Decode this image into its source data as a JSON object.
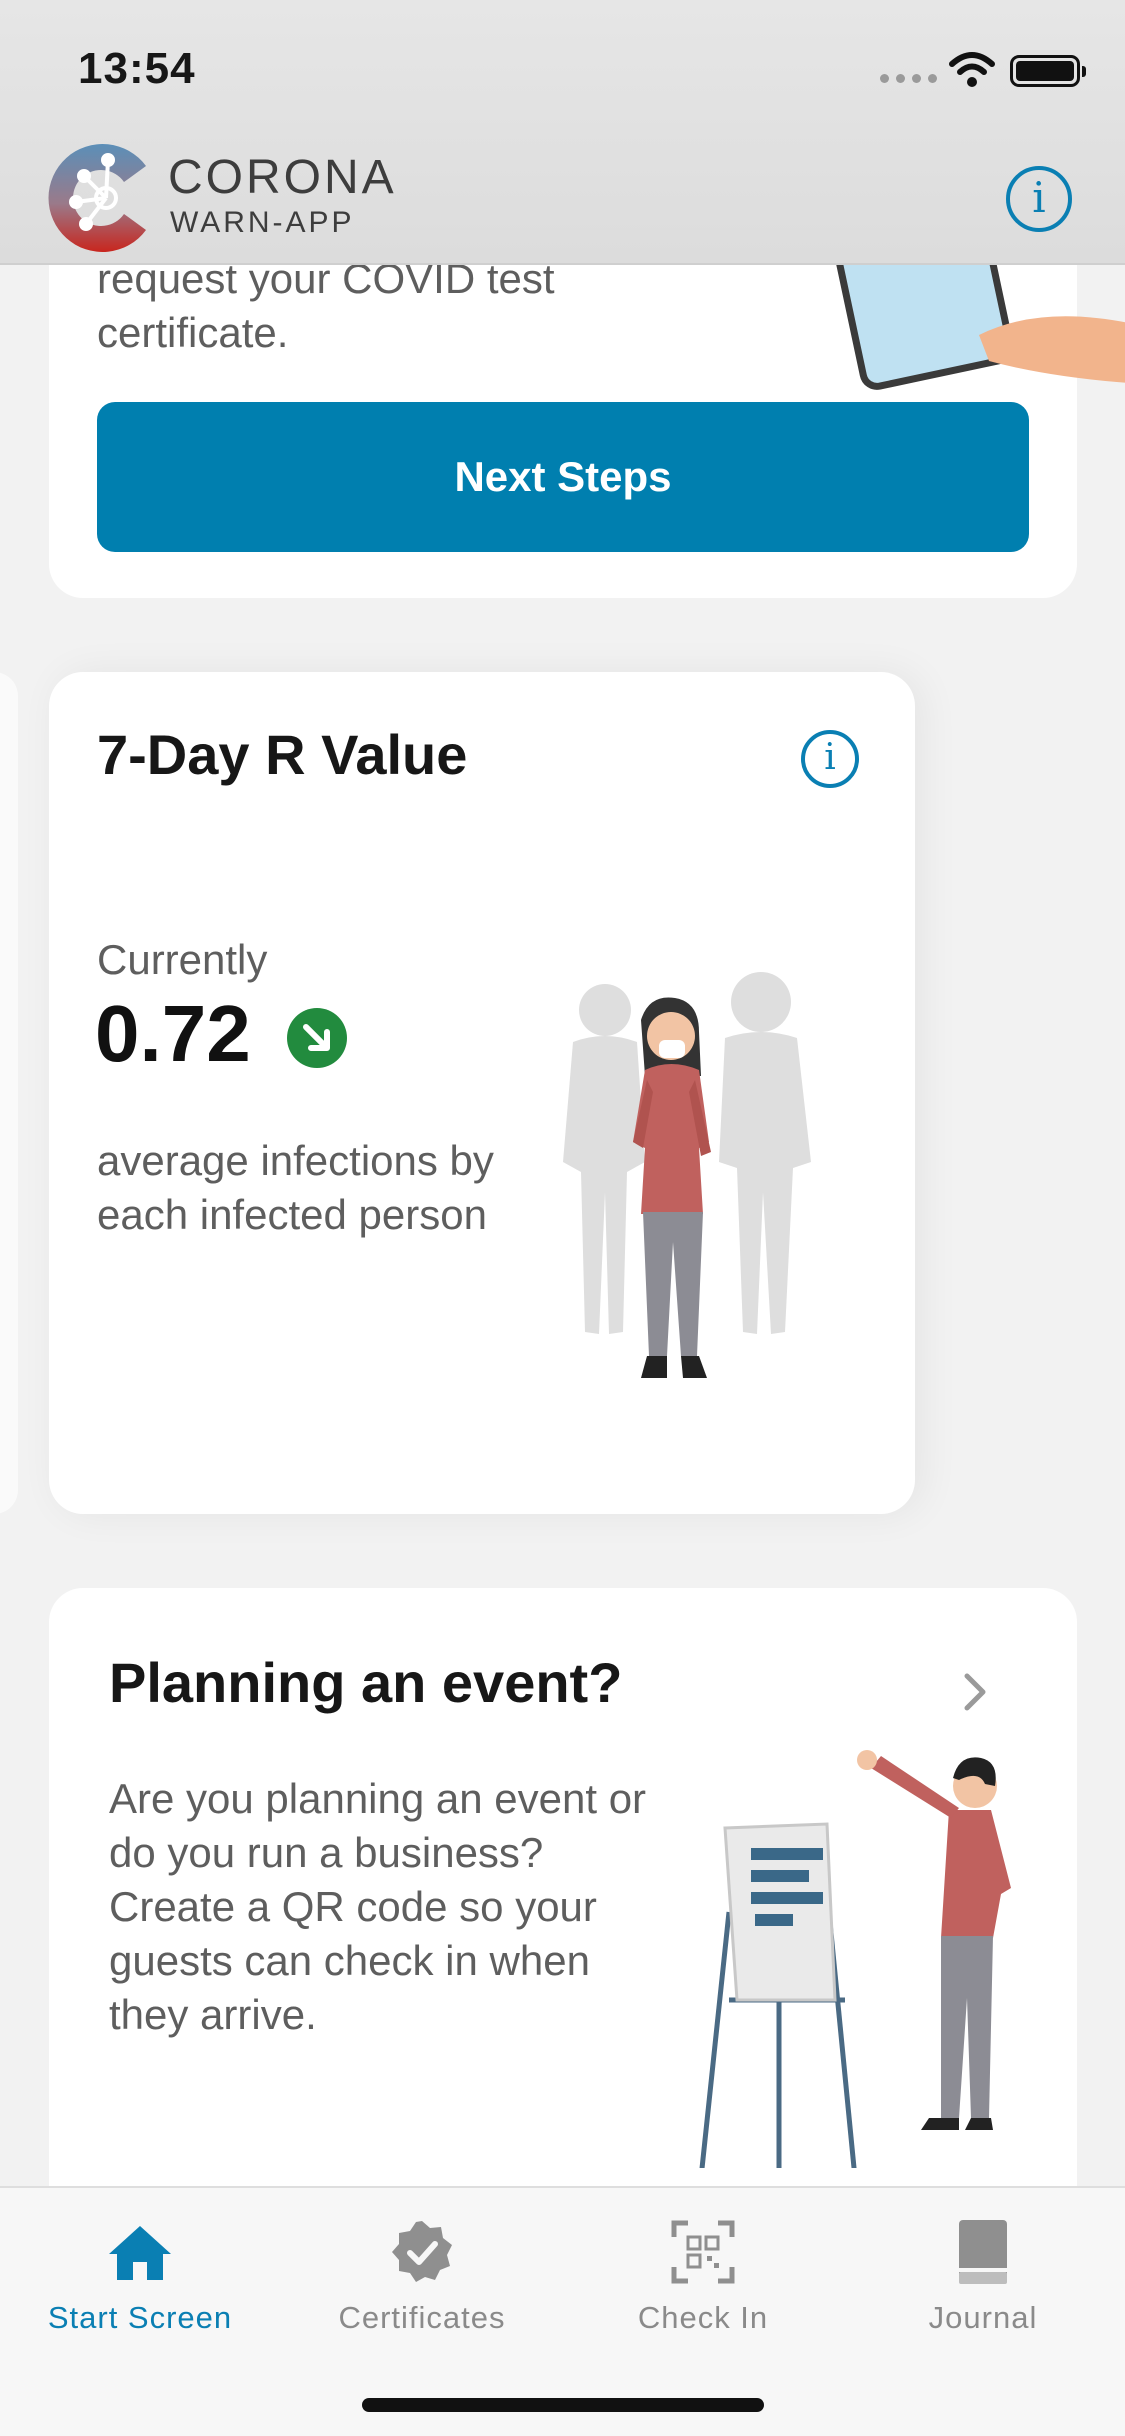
{
  "status_bar": {
    "time": "13:54"
  },
  "header": {
    "brand_line1": "CORONA",
    "brand_line2": "WARN-APP"
  },
  "test_certificate_card": {
    "text": "request your COVID test certificate.",
    "button_label": "Next Steps"
  },
  "r_value_card": {
    "title": "7-Day R Value",
    "currently_label": "Currently",
    "value": "0.72",
    "trend": "decreasing",
    "description": "average infections by each infected person"
  },
  "event_card": {
    "title": "Planning an event?",
    "text": "Are you planning an event or do you run a business? Create a QR code so your guests can check in when they arrive."
  },
  "tab_bar": {
    "tabs": [
      {
        "label": "Start Screen",
        "icon": "home-icon",
        "active": true
      },
      {
        "label": "Certificates",
        "icon": "certificate-badge-icon",
        "active": false
      },
      {
        "label": "Check In",
        "icon": "qr-scan-icon",
        "active": false
      },
      {
        "label": "Journal",
        "icon": "book-icon",
        "active": false
      }
    ]
  },
  "colors": {
    "accent": "#007FAF",
    "trend_green": "#228B3E",
    "inactive_tab": "#8A8A8A"
  }
}
